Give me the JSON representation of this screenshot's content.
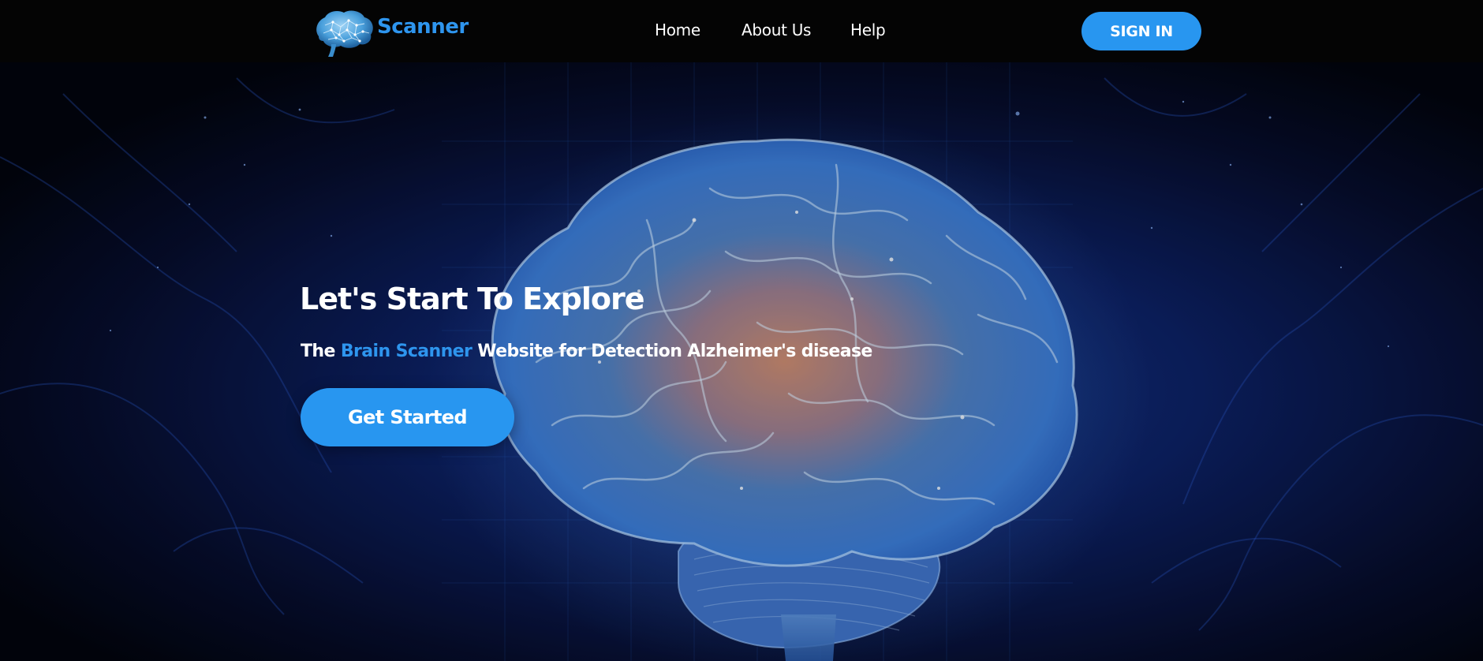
{
  "brand": {
    "name": "Scanner",
    "logo_icon": "brain-icon",
    "accent_color": "#2e95ee"
  },
  "nav": {
    "items": [
      {
        "label": "Home"
      },
      {
        "label": "About Us"
      },
      {
        "label": "Help"
      }
    ],
    "signin_label": "SIGN IN"
  },
  "hero": {
    "title": "Let's Start To Explore",
    "subtitle_prefix": "The ",
    "subtitle_highlight": "Brain Scanner",
    "subtitle_suffix": " Website for Detection Alzheimer's disease",
    "cta_label": "Get Started",
    "background": "brain-scan-image"
  },
  "colors": {
    "navbar_bg": "#040404",
    "button_bg": "#2896f0",
    "text": "#ffffff",
    "hero_bg": "#03050b"
  }
}
